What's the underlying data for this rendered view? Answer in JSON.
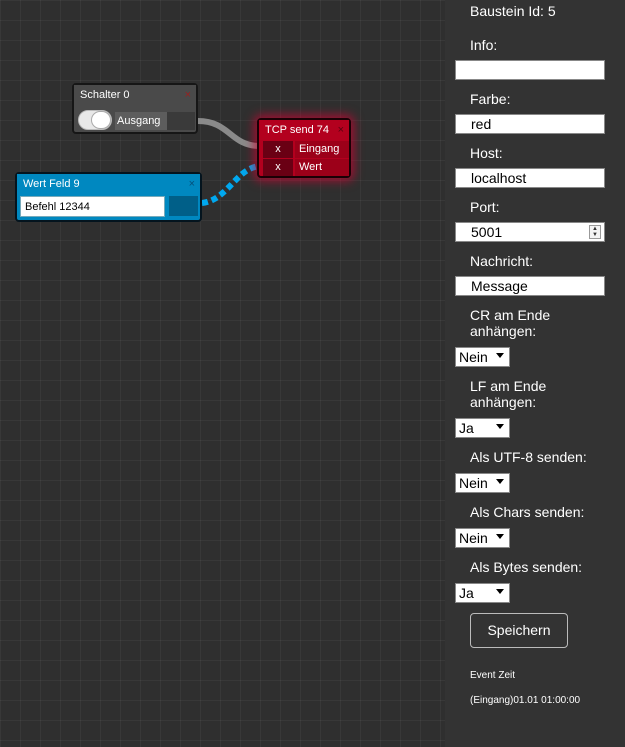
{
  "nodes": {
    "schalter": {
      "title": "Schalter 0",
      "close": "×",
      "output_label": "Ausgang"
    },
    "tcp": {
      "title": "TCP send 74",
      "close": "×",
      "inputs": [
        {
          "x": "x",
          "label": "Eingang"
        },
        {
          "x": "x",
          "label": "Wert"
        }
      ]
    },
    "wert": {
      "title": "Wert Feld 9",
      "close": "×",
      "value": "Befehl 12344"
    }
  },
  "colors": {
    "schalter": "#4a4a4a",
    "tcp": "#b3001e",
    "wert": "#0088c0",
    "wire_active": "#00a8ef",
    "wire_idle": "#8a8a8a"
  },
  "panel": {
    "baustein_id": "Baustein Id: 5",
    "info_label": "Info:",
    "info_value": "",
    "farbe_label": "Farbe:",
    "farbe_value": "red",
    "host_label": "Host:",
    "host_value": "localhost",
    "port_label": "Port:",
    "port_value": "5001",
    "nachricht_label": "Nachricht:",
    "nachricht_value": "Message",
    "cr_label_1": "CR am Ende",
    "cr_label_2": "anhängen:",
    "cr_value": "Nein",
    "lf_label_1": "LF am Ende",
    "lf_label_2": "anhängen:",
    "lf_value": "Ja",
    "utf8_label": "Als UTF-8 senden:",
    "utf8_value": "Nein",
    "chars_label": "Als Chars senden:",
    "chars_value": "Nein",
    "bytes_label": "Als Bytes senden:",
    "bytes_value": "Ja",
    "save_label": "Speichern",
    "event_header": "Event Zeit",
    "event_row": "(Eingang)01.01 01:00:00"
  }
}
